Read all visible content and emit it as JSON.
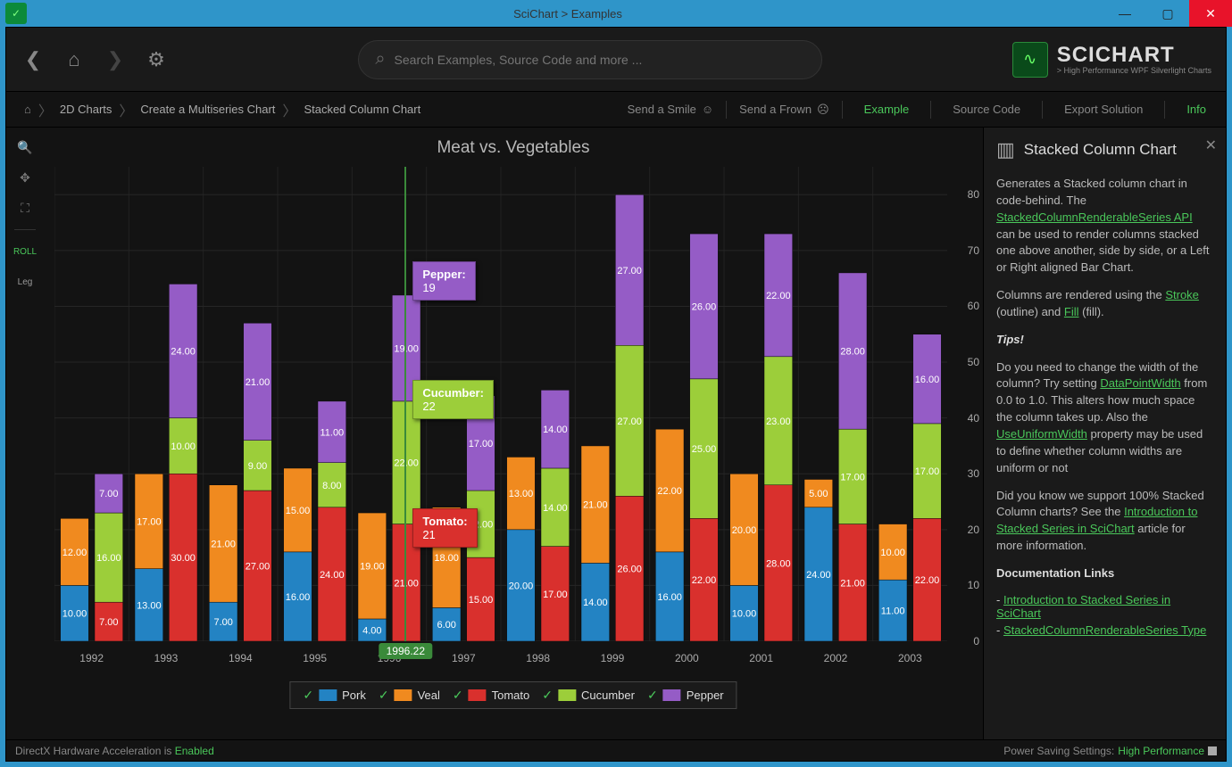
{
  "window": {
    "title": "SciChart > Examples"
  },
  "search": {
    "placeholder": "Search Examples, Source Code and more ..."
  },
  "logo": {
    "name": "SCICHART",
    "tagline": "> High Performance WPF Silverlight Charts"
  },
  "breadcrumbs": [
    "2D Charts",
    "Create a Multiseries Chart",
    "Stacked Column Chart"
  ],
  "feedback": {
    "smile": "Send a Smile",
    "frown": "Send a Frown"
  },
  "tabs": {
    "example": "Example",
    "source": "Source Code",
    "export": "Export Solution",
    "info": "Info"
  },
  "toolbar": {
    "roll": "ROLL",
    "leg": "Leg"
  },
  "chart": {
    "title": "Meat vs. Vegetables",
    "cursor_label": "1996.22",
    "tooltips": {
      "pepper": {
        "title": "Pepper:",
        "value": "19"
      },
      "cucumber": {
        "title": "Cucumber:",
        "value": "22"
      },
      "tomato": {
        "title": "Tomato:",
        "value": "21"
      }
    },
    "legend": [
      "Pork",
      "Veal",
      "Tomato",
      "Cucumber",
      "Pepper"
    ]
  },
  "chart_data": {
    "type": "bar",
    "title": "Meat vs. Vegetables",
    "categories": [
      "1992",
      "1993",
      "1994",
      "1995",
      "1996",
      "1997",
      "1998",
      "1999",
      "2000",
      "2001",
      "2002",
      "2003"
    ],
    "ylim": [
      0,
      85
    ],
    "yticks": [
      0,
      10,
      20,
      30,
      40,
      50,
      60,
      70,
      80
    ],
    "group1_series": [
      {
        "name": "Pork",
        "color": "#2383c3",
        "values": [
          10,
          13,
          7,
          16,
          4,
          6,
          20,
          14,
          16,
          10,
          24,
          11
        ]
      },
      {
        "name": "Veal",
        "color": "#f08a1f",
        "values": [
          12,
          17,
          21,
          15,
          19,
          18,
          13,
          21,
          22,
          20,
          5,
          10
        ]
      }
    ],
    "group2_series": [
      {
        "name": "Tomato",
        "color": "#d9302d",
        "values": [
          7,
          30,
          27,
          24,
          21,
          15,
          17,
          26,
          22,
          28,
          21,
          22
        ]
      },
      {
        "name": "Cucumber",
        "color": "#9cce3a",
        "values": [
          16,
          10,
          9,
          8,
          22,
          12,
          14,
          27,
          25,
          23,
          17,
          17
        ]
      },
      {
        "name": "Pepper",
        "color": "#955cc6",
        "values": [
          7,
          24,
          21,
          11,
          19,
          17,
          14,
          27,
          26,
          22,
          28,
          16
        ]
      }
    ]
  },
  "sidepanel": {
    "title": "Stacked Column Chart",
    "p1a": "Generates a Stacked column chart in code-behind. The ",
    "link1": "StackedColumnRenderableSeries API",
    "p1b": " can be used to render columns stacked one above another, side by side, or a Left or Right aligned Bar Chart.",
    "p2a": "Columns are rendered using the ",
    "link2": "Stroke",
    "p2b": " (outline) and ",
    "link3": "Fill",
    "p2c": " (fill).",
    "tips": "Tips!",
    "p3a": "Do you need to change the width of the column? Try setting ",
    "link4": "DataPointWidth",
    "p3b": " from 0.0 to 1.0. This alters how much space the column takes up. Also the ",
    "link5": "UseUniformWidth",
    "p3c": " property may be used to define whether column widths are uniform or not",
    "p4a": "Did you know we support 100% Stacked Column charts? See the ",
    "link6": "Introduction to Stacked Series in SciChart",
    "p4b": " article for more information.",
    "docs_head": "Documentation Links",
    "doc1": "Introduction to Stacked Series in SciChart",
    "doc2": "StackedColumnRenderableSeries Type"
  },
  "status": {
    "left_a": "DirectX Hardware Acceleration is ",
    "left_b": "Enabled",
    "right_a": "Power Saving Settings: ",
    "right_b": "High Performance"
  }
}
